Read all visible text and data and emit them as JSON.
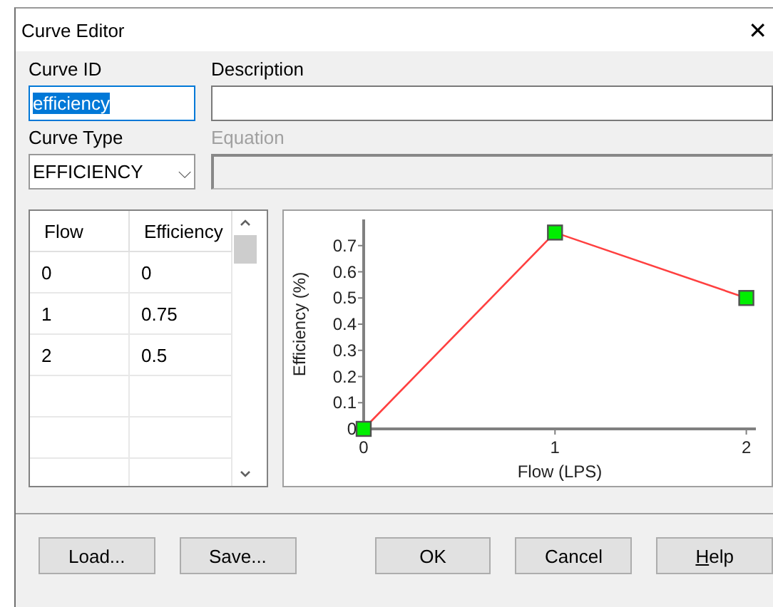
{
  "window": {
    "title": "Curve Editor",
    "close": "✕"
  },
  "curve_id": {
    "label": "Curve ID",
    "value": "efficiency",
    "text_selected": true
  },
  "description": {
    "label": "Description"
  },
  "curve_type": {
    "label": "Curve Type",
    "value": "EFFICIENCY",
    "caret": "⌵"
  },
  "equation": {
    "label": "Equation",
    "disabled": true
  },
  "table": {
    "columns": [
      "Flow",
      "Efficiency"
    ],
    "rows": [
      [
        "0",
        "0"
      ],
      [
        "1",
        "0.75"
      ],
      [
        "2",
        "0.5"
      ]
    ]
  },
  "chart": {
    "chart_data": {
      "type": "line",
      "xlabel": "Flow (LPS)",
      "ylabel": "Efficiency (%)",
      "x": [
        0,
        1,
        2
      ],
      "series": [
        {
          "color": "#ff4040",
          "marker": "square",
          "values": [
            0,
            0.75,
            0.5
          ]
        }
      ],
      "xlim": [
        0,
        2.05
      ],
      "ylim": [
        0,
        0.8
      ],
      "xticks": [
        {
          "value": 0,
          "label": "0"
        },
        {
          "value": 1,
          "label": "1"
        },
        {
          "value": 2,
          "label": "2"
        }
      ],
      "yticks": [
        {
          "value": 0,
          "label": "0"
        },
        {
          "value": 0.1,
          "label": "0.1"
        },
        {
          "value": 0.2,
          "label": "0.2"
        },
        {
          "value": 0.3,
          "label": "0.3"
        },
        {
          "value": 0.4,
          "label": "0.4"
        },
        {
          "value": 0.5,
          "label": "0.5"
        },
        {
          "value": 0.6,
          "label": "0.6"
        },
        {
          "value": 0.7,
          "label": "0.7"
        }
      ]
    }
  },
  "buttons": [
    {
      "label": "Load...",
      "gap_before": false,
      "underline_first": false
    },
    {
      "label": "Save...",
      "gap_before": false,
      "underline_first": false
    },
    {
      "label": "OK",
      "gap_before": true,
      "underline_first": false
    },
    {
      "label": "Cancel",
      "gap_before": false,
      "underline_first": false
    },
    {
      "label": "Help",
      "gap_before": false,
      "underline_first": true
    }
  ]
}
